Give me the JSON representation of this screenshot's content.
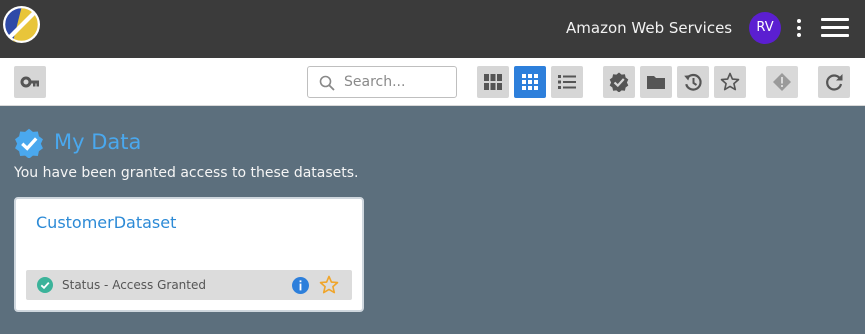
{
  "header": {
    "org_name": "Amazon Web Services",
    "avatar_initials": "RV",
    "avatar_color": "#5b1fd1"
  },
  "toolbar": {
    "search_placeholder": "Search...",
    "buttons": [
      "key-icon",
      "large-grid-icon",
      "small-grid-icon",
      "list-icon",
      "verified-icon",
      "folder-icon",
      "history-icon",
      "star-icon",
      "warning-icon",
      "refresh-icon"
    ],
    "active_view": "small-grid",
    "accent_color": "#2d7fdb"
  },
  "main": {
    "title": "My Data",
    "subtitle": "You have been granted access to these datasets.",
    "title_color": "#4aa8ee"
  },
  "datasets": [
    {
      "name": "CustomerDataset",
      "status": "Status - Access Granted",
      "status_color": "#3bb39a",
      "favorite": false
    }
  ]
}
